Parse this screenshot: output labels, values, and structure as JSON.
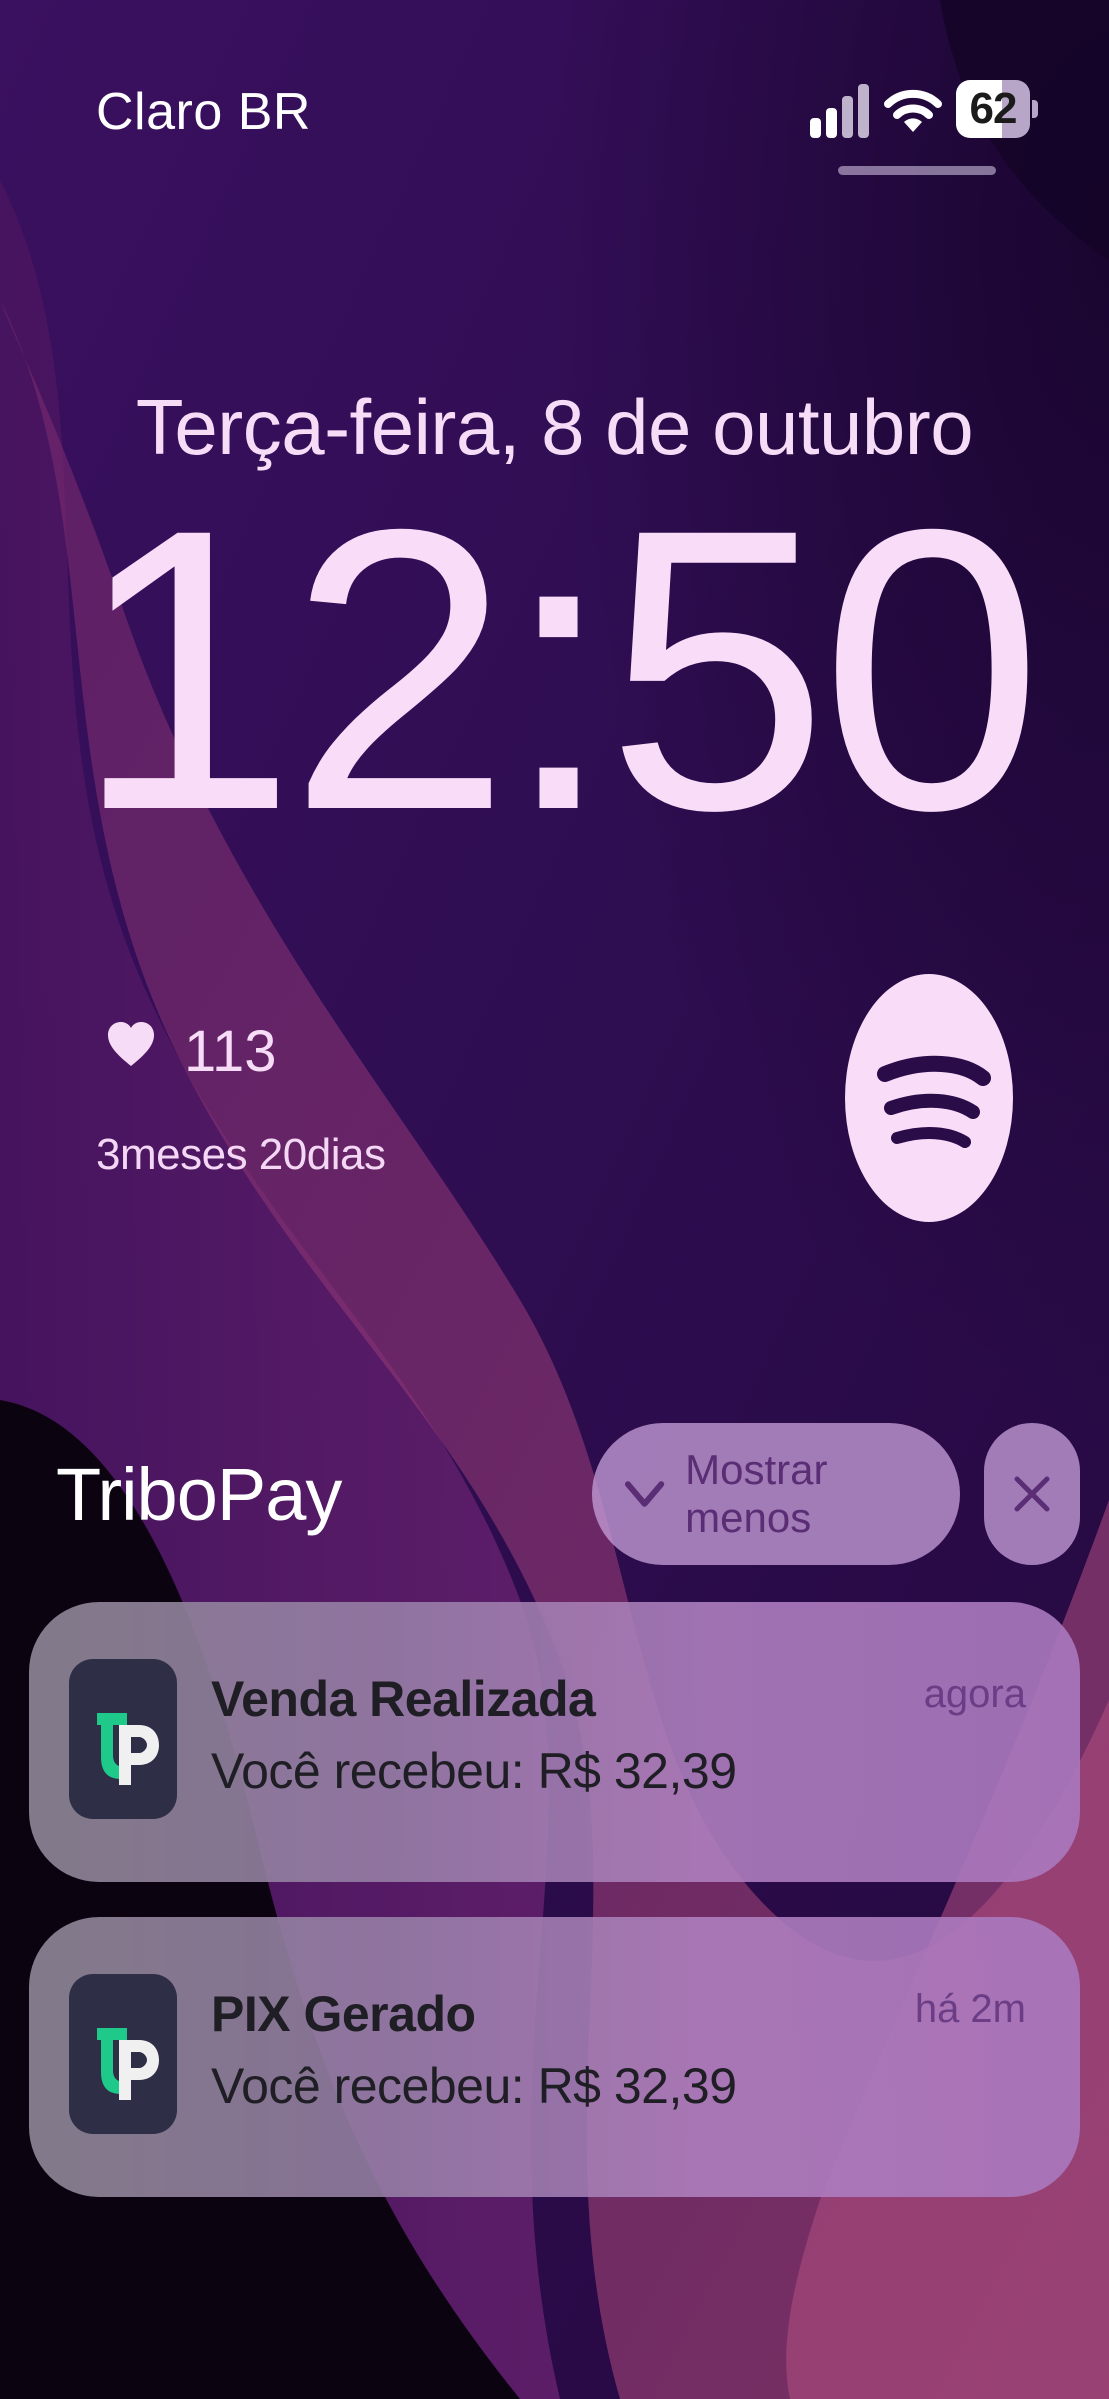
{
  "status_bar": {
    "carrier": "Claro BR",
    "battery_level": "62",
    "icons": [
      "cellular-signal-icon",
      "wifi-icon",
      "battery-icon"
    ]
  },
  "lock_screen": {
    "date": "Terça-feira, 8 de outubro",
    "time": "12:50"
  },
  "widgets": {
    "heart": {
      "icon": "heart-icon",
      "count": "113",
      "duration": "3meses 20dias"
    },
    "spotify": {
      "icon": "spotify-icon"
    }
  },
  "notification_group": {
    "app_name": "TriboPay",
    "show_less_label": "Mostrar menos",
    "show_less_icon": "chevron-down-icon",
    "close_icon": "close-icon",
    "notifications": [
      {
        "title": "Venda Realizada",
        "body": "Você recebeu: R$ 32,39",
        "time": "agora",
        "icon": "tribopay-app-icon"
      },
      {
        "title": "PIX Gerado",
        "body": "Você recebeu: R$ 32,39",
        "time": "há 2m",
        "icon": "tribopay-app-icon"
      }
    ]
  },
  "colors": {
    "wallpaper_base": "#2a0c48",
    "wave": "#a2407a",
    "text_light": "#f8dcf8",
    "button_bg": "#c49cd6",
    "button_text": "#5a2d75",
    "app_icon_bg": "#2e2e47",
    "app_icon_accent": "#1fc98a"
  }
}
